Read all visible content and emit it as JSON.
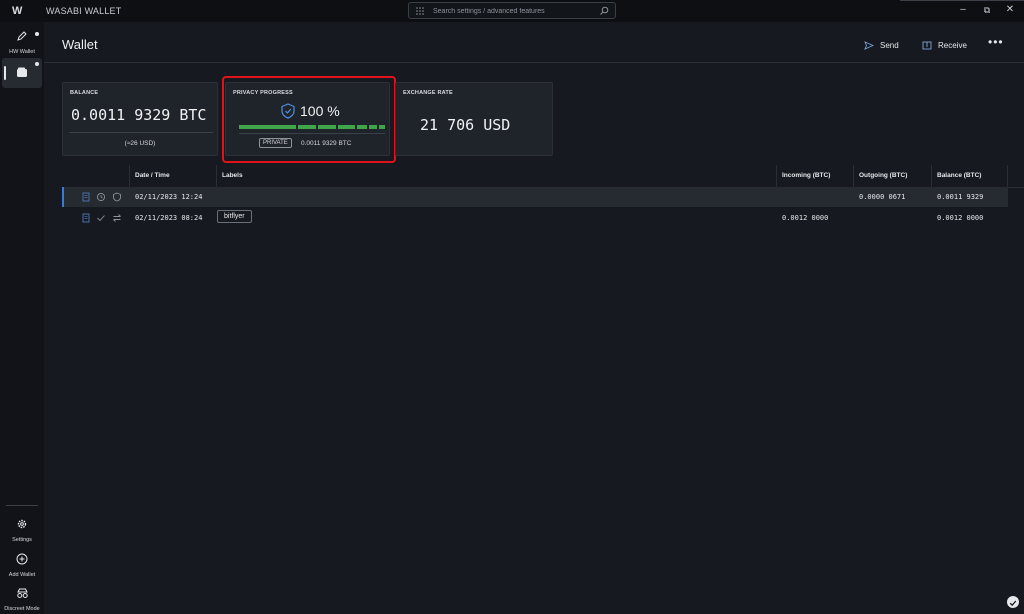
{
  "app": {
    "title": "WASABI WALLET",
    "logo": "W"
  },
  "search": {
    "placeholder": "Search settings / advanced features"
  },
  "sidebar": {
    "top_items": [
      {
        "label": "HW Wallet",
        "icon": "pen-icon"
      },
      {
        "label": "",
        "icon": "wallet-icon"
      }
    ],
    "bottom_items": [
      {
        "label": "Settings",
        "icon": "gear-icon"
      },
      {
        "label": "Add Wallet",
        "icon": "plus-circle-icon"
      },
      {
        "label": "Discreet Mode",
        "icon": "incognito-icon"
      }
    ]
  },
  "header": {
    "title": "Wallet",
    "send_label": "Send",
    "receive_label": "Receive",
    "more_label": "•••"
  },
  "tiles": {
    "balance": {
      "label": "BALANCE",
      "value": "0.0011 9329 BTC",
      "usd": "(≈26 USD)"
    },
    "privacy": {
      "label": "PRIVACY PROGRESS",
      "percent": "100 %",
      "progress": 1.0,
      "badge": "PRIVATE",
      "amount": "0.0011 9329 BTC"
    },
    "exchange": {
      "label": "EXCHANGE RATE",
      "value": "21 706 USD"
    }
  },
  "table": {
    "headers": {
      "datetime": "Date / Time",
      "labels": "Labels",
      "incoming": "Incoming (BTC)",
      "outgoing": "Outgoing (BTC)",
      "balance": "Balance (BTC)"
    },
    "rows": [
      {
        "datetime": "02/11/2023 12:24",
        "label": "",
        "incoming": "",
        "outgoing": "0.0000 0671",
        "balance": "0.0011 9329",
        "status": "pending"
      },
      {
        "datetime": "02/11/2023 08:24",
        "label": "bitflyer",
        "incoming": "0.0012 0000",
        "outgoing": "",
        "balance": "0.0012 0000",
        "status": "confirmed"
      }
    ]
  },
  "colors": {
    "accent": "#3fa54a",
    "highlight": "#e0131a",
    "selection": "#3a7bd5"
  }
}
